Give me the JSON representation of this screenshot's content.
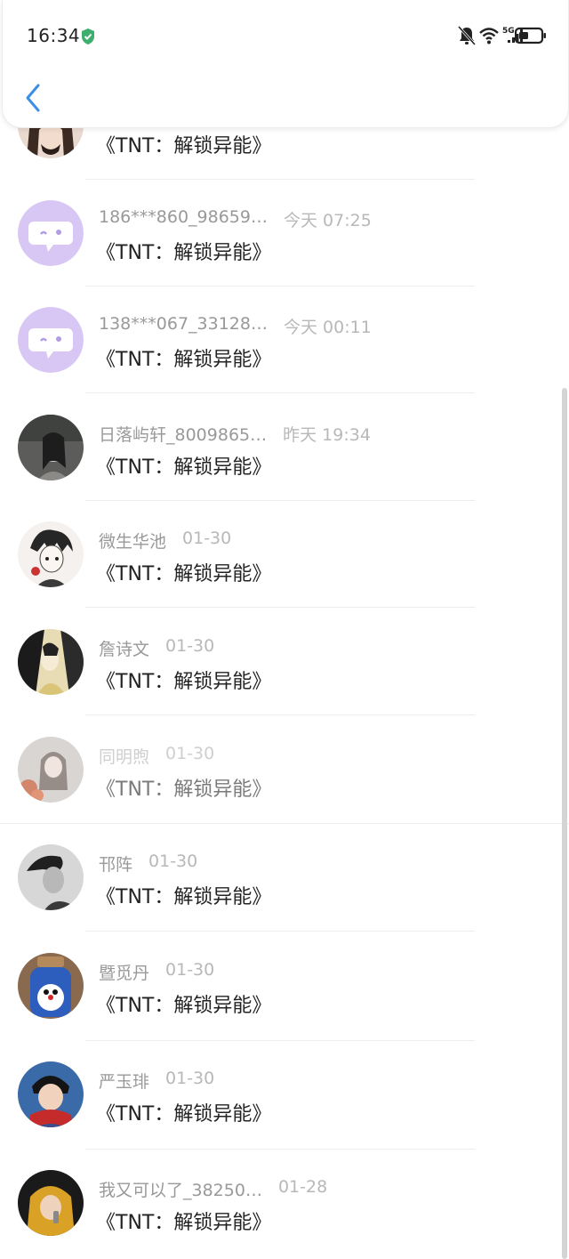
{
  "status_bar": {
    "time": "16:34",
    "network_label": "5G",
    "icons": [
      "verified-shield-icon",
      "mute-bell-icon",
      "wifi-icon",
      "signal-icon",
      "battery-icon"
    ],
    "colors": {
      "shield": "#3cae6e",
      "text": "#222222"
    }
  },
  "header": {
    "back_icon": "chevron-left-icon",
    "accent": "#3b8ee6"
  },
  "comments": [
    {
      "name": "",
      "date": "",
      "text": "《TNT：解锁异能》",
      "avatar": "photo-man-longhair"
    },
    {
      "name": "186***860_98659…",
      "date": "今天 07:25",
      "text": "《TNT：解锁异能》",
      "avatar": "default-chat-avatar"
    },
    {
      "name": "138***067_33128…",
      "date": "今天 00:11",
      "text": "《TNT：解锁异能》",
      "avatar": "default-chat-avatar"
    },
    {
      "name": "日落屿轩_8009865…",
      "date": "昨天 19:34",
      "text": "《TNT：解锁异能》",
      "avatar": "photo-girl-mono"
    },
    {
      "name": "微生华池",
      "date": "01-30",
      "text": "《TNT：解锁异能》",
      "avatar": "anime-sketch"
    },
    {
      "name": "詹诗文",
      "date": "01-30",
      "text": "《TNT：解锁异能》",
      "avatar": "anime-couple"
    },
    {
      "name": "同明煦",
      "date": "01-30",
      "text": "《TNT：解锁异能》",
      "avatar": "photo-girl-red"
    },
    {
      "name": "邗阵",
      "date": "01-30",
      "text": "《TNT：解锁异能》",
      "avatar": "photo-man-mono"
    },
    {
      "name": "暨觅丹",
      "date": "01-30",
      "text": "《TNT：解锁异能》",
      "avatar": "doraemon-jar"
    },
    {
      "name": "严玉琲",
      "date": "01-30",
      "text": "《TNT：解锁异能》",
      "avatar": "photo-child-scarf"
    },
    {
      "name": "我又可以了_38250…",
      "date": "01-28",
      "text": "《TNT：解锁异能》",
      "avatar": "photo-singer-yellow"
    }
  ]
}
